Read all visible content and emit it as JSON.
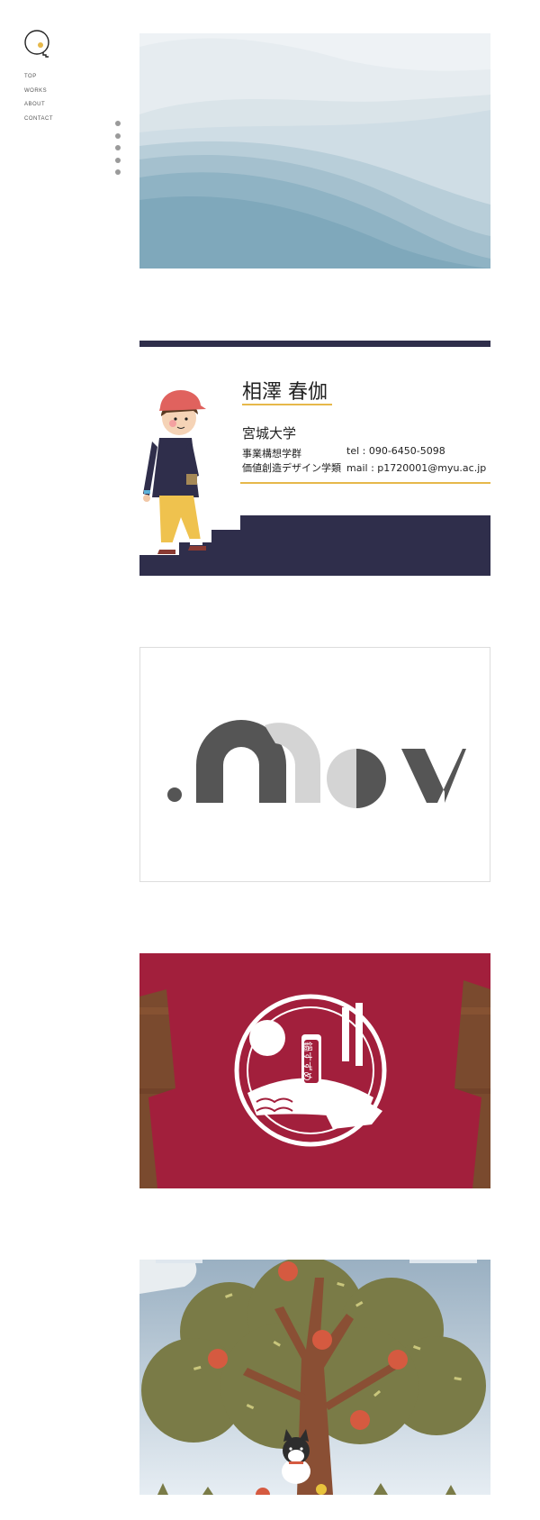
{
  "nav": {
    "items": [
      "TOP",
      "WORKS",
      "ABOUT",
      "CONTACT"
    ]
  },
  "card": {
    "name": "相澤 春伽",
    "university": "宮城大学",
    "faculty": "事業構想学群",
    "department": "価値創造デザイン学類",
    "tel": "tel : 090-6450-5098",
    "mail": "mail : p1720001@myu.ac.jp"
  },
  "tshirt": {
    "label": "鍋すずめ"
  },
  "colors": {
    "navy": "#2f2e4b",
    "gold": "#e6b84a",
    "shirt": "#a21f3c",
    "tree": "#7a7b47",
    "apple": "#d55a40",
    "wave": "#7fa8bb"
  }
}
